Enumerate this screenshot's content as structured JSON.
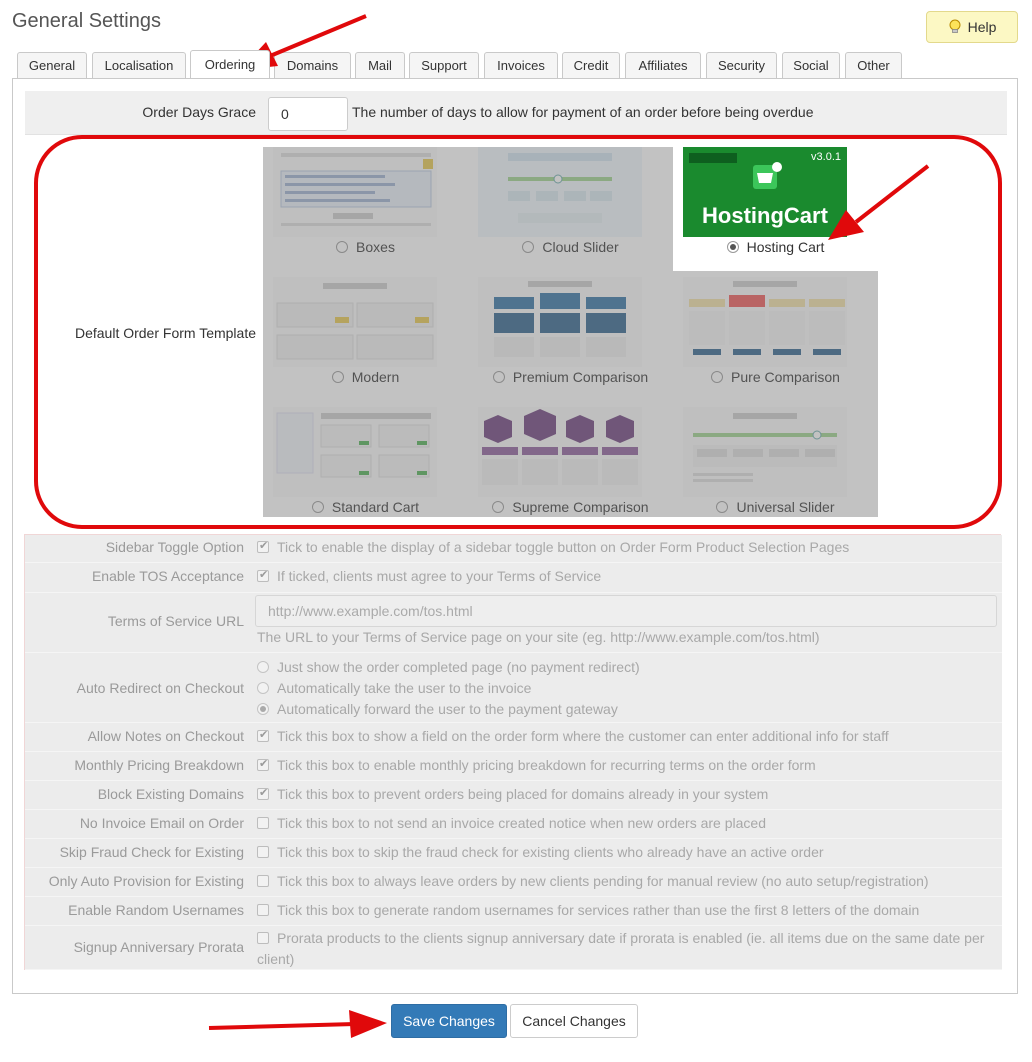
{
  "page": {
    "title": "General Settings",
    "help_label": "Help"
  },
  "tabs": [
    {
      "label": "General"
    },
    {
      "label": "Localisation"
    },
    {
      "label": "Ordering",
      "active": true
    },
    {
      "label": "Domains"
    },
    {
      "label": "Mail"
    },
    {
      "label": "Support"
    },
    {
      "label": "Invoices"
    },
    {
      "label": "Credit"
    },
    {
      "label": "Affiliates"
    },
    {
      "label": "Security"
    },
    {
      "label": "Social"
    },
    {
      "label": "Other"
    }
  ],
  "order_days_grace": {
    "label": "Order Days Grace",
    "value": "0",
    "help": "The number of days to allow for payment of an order before being overdue"
  },
  "order_form_template": {
    "label": "Default Order Form Template",
    "selected": "Hosting Cart",
    "templates": [
      {
        "label": "Boxes"
      },
      {
        "label": "Cloud Slider"
      },
      {
        "label": "Hosting Cart",
        "badge": "v3.0.1",
        "brand": "HostingCart"
      },
      {
        "label": "Modern"
      },
      {
        "label": "Premium Comparison"
      },
      {
        "label": "Pure Comparison"
      },
      {
        "label": "Standard Cart"
      },
      {
        "label": "Supreme Comparison"
      },
      {
        "label": "Universal Slider"
      }
    ]
  },
  "settings": {
    "sidebar_toggle": {
      "label": "Sidebar Toggle Option",
      "text": "Tick to enable the display of a sidebar toggle button on Order Form Product Selection Pages",
      "checked": true
    },
    "tos_acceptance": {
      "label": "Enable TOS Acceptance",
      "text": "If ticked, clients must agree to your Terms of Service",
      "checked": true
    },
    "tos_url": {
      "label": "Terms of Service URL",
      "placeholder": "http://www.example.com/tos.html",
      "help": "The URL to your Terms of Service page on your site (eg. http://www.example.com/tos.html)"
    },
    "auto_redirect": {
      "label": "Auto Redirect on Checkout",
      "options": [
        "Just show the order completed page (no payment redirect)",
        "Automatically take the user to the invoice",
        "Automatically forward the user to the payment gateway"
      ],
      "selected_index": 2
    },
    "notes_on_checkout": {
      "label": "Allow Notes on Checkout",
      "text": "Tick this box to show a field on the order form where the customer can enter additional info for staff",
      "checked": true
    },
    "monthly_pricing": {
      "label": "Monthly Pricing Breakdown",
      "text": "Tick this box to enable monthly pricing breakdown for recurring terms on the order form",
      "checked": true
    },
    "block_domains": {
      "label": "Block Existing Domains",
      "text": "Tick this box to prevent orders being placed for domains already in your system",
      "checked": true
    },
    "no_invoice_email": {
      "label": "No Invoice Email on Order",
      "text": "Tick this box to not send an invoice created notice when new orders are placed",
      "checked": false
    },
    "skip_fraud": {
      "label": "Skip Fraud Check for Existing",
      "text": "Tick this box to skip the fraud check for existing clients who already have an active order",
      "checked": false
    },
    "auto_provision": {
      "label": "Only Auto Provision for Existing",
      "text": "Tick this box to always leave orders by new clients pending for manual review (no auto setup/registration)",
      "checked": false
    },
    "random_usernames": {
      "label": "Enable Random Usernames",
      "text": "Tick this box to generate random usernames for services rather than use the first 8 letters of the domain",
      "checked": false
    },
    "signup_prorata": {
      "label": "Signup Anniversary Prorata",
      "text": "Prorata products to the clients signup anniversary date if prorata is enabled (ie. all items due on the same date per client)",
      "checked": false
    }
  },
  "actions": {
    "save": "Save Changes",
    "cancel": "Cancel Changes"
  },
  "colors": {
    "annotation_red": "#e0090b",
    "primary": "#337ab7",
    "hosting_cart_green": "#1a8a2e"
  }
}
